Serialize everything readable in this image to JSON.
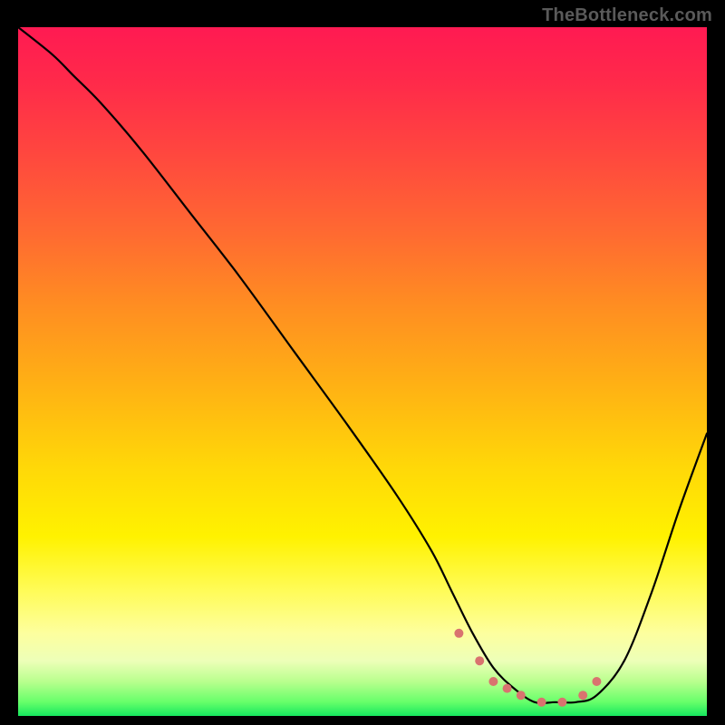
{
  "watermark": "TheBottleneck.com",
  "colors": {
    "curve_stroke": "#000000",
    "dot_fill": "#d9736f",
    "background": "#000000"
  },
  "chart_data": {
    "type": "line",
    "title": "",
    "xlabel": "",
    "ylabel": "",
    "xlim": [
      0,
      100
    ],
    "ylim": [
      0,
      100
    ],
    "series": [
      {
        "name": "bottleneck-curve",
        "x": [
          0,
          5,
          8,
          12,
          18,
          25,
          32,
          40,
          48,
          55,
          60,
          63,
          66,
          69,
          72,
          75,
          78,
          81,
          84,
          88,
          92,
          96,
          100
        ],
        "y": [
          100,
          96,
          93,
          89,
          82,
          73,
          64,
          53,
          42,
          32,
          24,
          18,
          12,
          7,
          4,
          2,
          2,
          2,
          3,
          8,
          18,
          30,
          41
        ]
      }
    ],
    "dots": {
      "name": "valley-markers",
      "x": [
        64,
        67,
        69,
        71,
        73,
        76,
        79,
        82,
        84
      ],
      "y": [
        12,
        8,
        5,
        4,
        3,
        2,
        2,
        3,
        5
      ],
      "radius": 5
    },
    "gradient_note": "Vertical rainbow gradient red→orange→yellow→green corresponds to y axis (top=100 red, bottom=0 green)."
  }
}
